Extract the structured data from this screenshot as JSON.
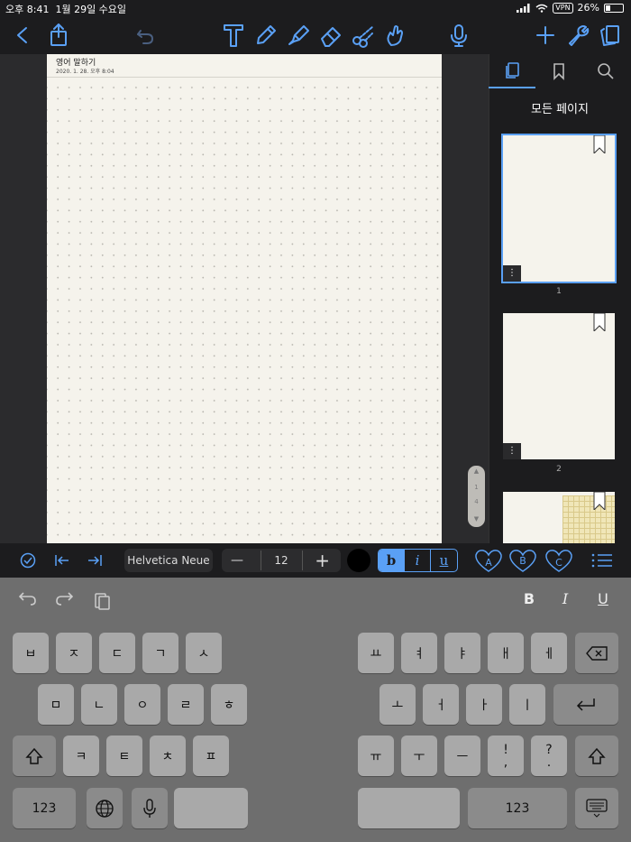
{
  "status": {
    "time": "오후 8:41",
    "date": "1월 29일 수요일",
    "vpn": "VPN",
    "battery": "26%",
    "battery_level": 0.26
  },
  "toolbar": {
    "icons": [
      "back-icon",
      "share-icon",
      "undo-icon",
      "text-tool-icon",
      "pen-icon",
      "highlighter-icon",
      "eraser-icon",
      "scissors-icon",
      "hand-icon",
      "mic-icon",
      "add-icon",
      "wrench-icon",
      "pages-icon"
    ]
  },
  "page": {
    "title": "영어 말하기",
    "date": "2020. 1. 28. 오후 8:04"
  },
  "scroller": {
    "top": "1",
    "bottom": "4"
  },
  "sidebar": {
    "heading": "모든 페이지",
    "thumbnails": [
      {
        "number": "1"
      },
      {
        "number": "2"
      }
    ],
    "menu_glyph": "⋮"
  },
  "format": {
    "font": "Helvetica Neue",
    "minus": "—",
    "size": "12",
    "plus": "+",
    "bold": "b",
    "italic": "i",
    "underline": "u",
    "presets": [
      "A",
      "B",
      "C"
    ]
  },
  "keyboard": {
    "top_right": {
      "bold": "B",
      "italic": "I",
      "underline": "U"
    },
    "row1_left": [
      "ㅂ",
      "ㅈ",
      "ㄷ",
      "ㄱ",
      "ㅅ"
    ],
    "row1_right": [
      "ㅛ",
      "ㅕ",
      "ㅑ",
      "ㅐ",
      "ㅔ"
    ],
    "row2_left": [
      "ㅁ",
      "ㄴ",
      "ㅇ",
      "ㄹ",
      "ㅎ"
    ],
    "row2_right": [
      "ㅗ",
      "ㅓ",
      "ㅏ",
      "ㅣ"
    ],
    "row3_left": [
      "ㅋ",
      "ㅌ",
      "ㅊ",
      "ㅍ"
    ],
    "row3_right": [
      "ㅠ",
      "ㅜ",
      "ㅡ"
    ],
    "punct1": {
      "top": "!",
      "bottom": ","
    },
    "punct2": {
      "top": "?",
      "bottom": "."
    },
    "num_label": "123"
  }
}
